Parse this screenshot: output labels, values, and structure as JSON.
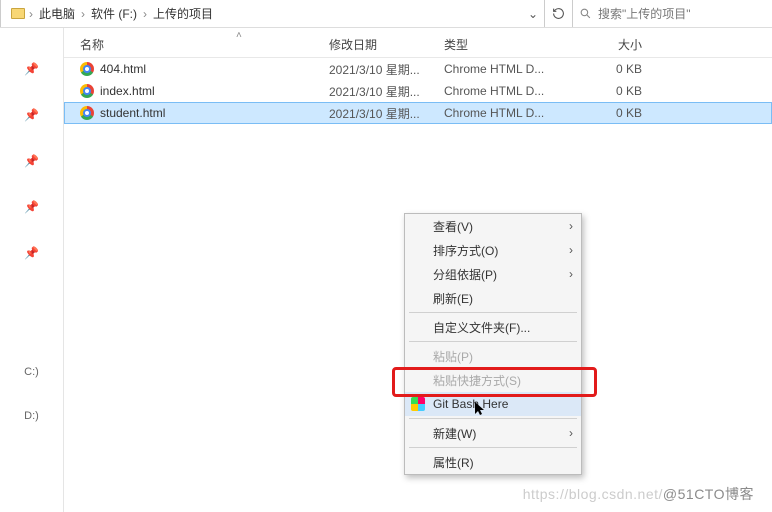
{
  "breadcrumb": {
    "root": "此电脑",
    "drive": "软件 (F:)",
    "folder": "上传的项目"
  },
  "search": {
    "placeholder": "搜索\"上传的项目\""
  },
  "columns": {
    "name": "名称",
    "date": "修改日期",
    "type": "类型",
    "size": "大小"
  },
  "gutter": {
    "drive_c": "C:)",
    "drive_d": "D:)"
  },
  "files": [
    {
      "name": "404.html",
      "date": "2021/3/10 星期...",
      "type": "Chrome HTML D...",
      "size": "0 KB",
      "selected": false
    },
    {
      "name": "index.html",
      "date": "2021/3/10 星期...",
      "type": "Chrome HTML D...",
      "size": "0 KB",
      "selected": false
    },
    {
      "name": "student.html",
      "date": "2021/3/10 星期...",
      "type": "Chrome HTML D...",
      "size": "0 KB",
      "selected": true
    }
  ],
  "context_menu": {
    "view": "查看(V)",
    "sort": "排序方式(O)",
    "group": "分组依据(P)",
    "refresh": "刷新(E)",
    "customize": "自定义文件夹(F)...",
    "paste": "粘贴(P)",
    "paste_shortcut": "粘贴快捷方式(S)",
    "git_bash": "Git Bash Here",
    "new": "新建(W)",
    "properties": "属性(R)"
  },
  "watermark": {
    "left": "https://blog.csdn.net/",
    "right": "@51CTO博客"
  }
}
